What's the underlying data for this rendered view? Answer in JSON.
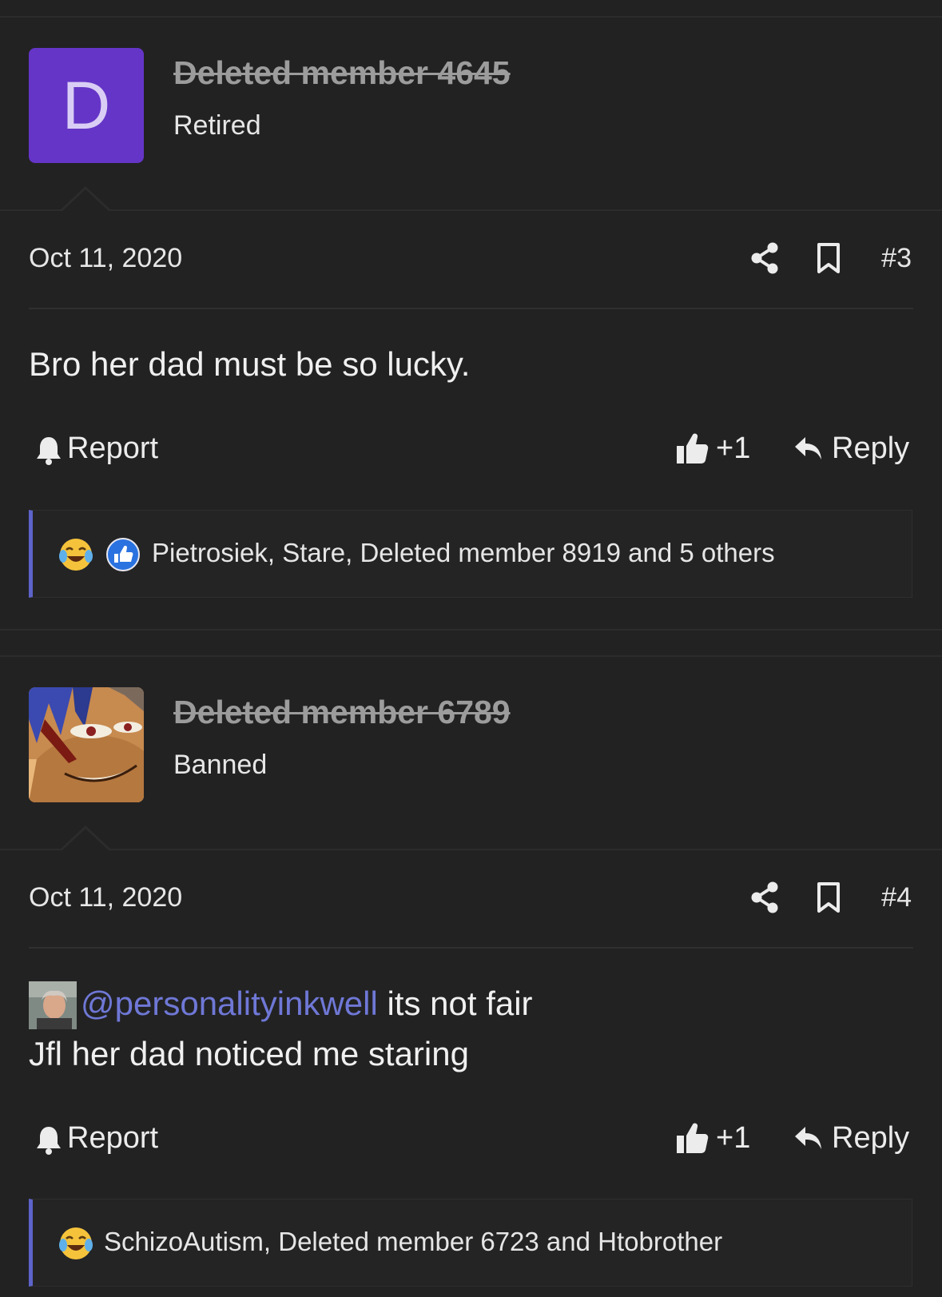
{
  "posts": [
    {
      "avatar_letter": "D",
      "avatar_color": "#6535c7",
      "username": "Deleted member 4645",
      "user_title": "Retired",
      "date": "Oct 11, 2020",
      "post_number": "#3",
      "message": "Bro her dad must be so lucky.",
      "report_label": "Report",
      "like_count": "+1",
      "reply_label": "Reply",
      "reactions": "Pietrosiek, Stare, Deleted member 8919 and 5 others"
    },
    {
      "username": "Deleted member 6789",
      "user_title": "Banned",
      "date": "Oct 11, 2020",
      "post_number": "#4",
      "mention": "@personalityinkwell",
      "message_line1_rest": " its not fair",
      "message_line2": "Jfl her dad noticed me staring",
      "report_label": "Report",
      "like_count": "+1",
      "reply_label": "Reply",
      "reactions": "SchizoAutism, Deleted member 6723 and Htobrother"
    }
  ],
  "colors": {
    "background": "#222223",
    "mention": "#6f78d6",
    "reaction_accent": "#5d63c9",
    "username_deleted": "#9c9c9c"
  },
  "icons": [
    "share-icon",
    "bookmark-icon",
    "bell-icon",
    "thumbs-up-icon",
    "reply-icon",
    "laughing-crying-emoji-icon",
    "like-reaction-icon"
  ]
}
